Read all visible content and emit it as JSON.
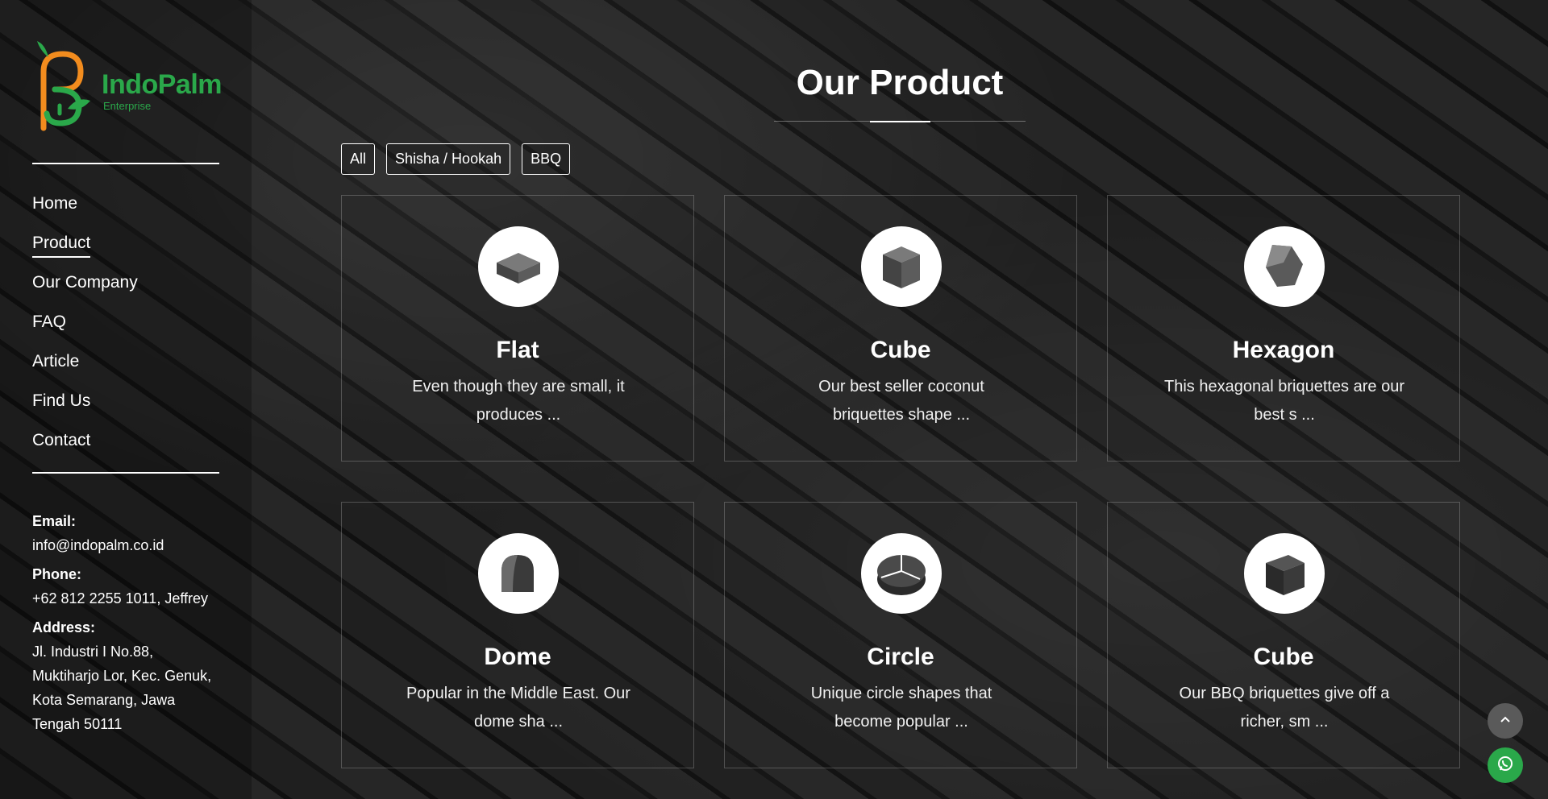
{
  "brand": {
    "name": "IndoPalm",
    "subtitle": "Enterprise",
    "colors": {
      "green": "#2aa84a",
      "orange": "#f28c1e"
    }
  },
  "sidebar": {
    "nav": [
      {
        "label": "Home",
        "active": false
      },
      {
        "label": "Product",
        "active": true
      },
      {
        "label": "Our Company",
        "active": false
      },
      {
        "label": "FAQ",
        "active": false
      },
      {
        "label": "Article",
        "active": false
      },
      {
        "label": "Find Us",
        "active": false
      },
      {
        "label": "Contact",
        "active": false
      }
    ],
    "contact": {
      "email_label": "Email:",
      "email": "info@indopalm.co.id",
      "phone_label": "Phone:",
      "phone": "+62 812 2255 1011, Jeffrey",
      "address_label": "Address:",
      "address_line1": "Jl. Industri I No.88,",
      "address_line2": "Muktiharjo Lor, Kec. Genuk,",
      "address_line3": "Kota Semarang, Jawa",
      "address_line4": "Tengah 50111"
    }
  },
  "main": {
    "title": "Our Product",
    "filters": [
      "All",
      "Shisha / Hookah",
      "BBQ"
    ],
    "products": [
      {
        "name": "Flat",
        "desc": "Even though they are small, it produces ...",
        "icon": "flat-briquette-icon"
      },
      {
        "name": "Cube",
        "desc": "Our best seller coconut briquettes shape ...",
        "icon": "cube-briquette-icon"
      },
      {
        "name": "Hexagon",
        "desc": "This hexagonal briquettes are our best s ...",
        "icon": "hexagon-briquette-icon"
      },
      {
        "name": "Dome",
        "desc": "Popular in the Middle East. Our dome sha ...",
        "icon": "dome-briquette-icon"
      },
      {
        "name": "Circle",
        "desc": "Unique circle shapes that become popular ...",
        "icon": "circle-briquette-icon"
      },
      {
        "name": "Cube",
        "desc": "Our BBQ briquettes give off a richer, sm ...",
        "icon": "bbq-cube-briquette-icon"
      }
    ]
  },
  "floating": {
    "scroll_top_icon": "chevron-up-icon",
    "whatsapp_icon": "whatsapp-icon"
  }
}
